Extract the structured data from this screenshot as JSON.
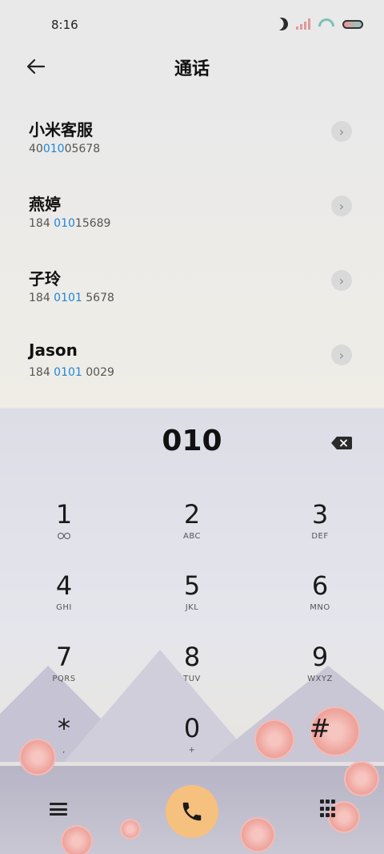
{
  "status_bar": {
    "time": "8:16"
  },
  "header": {
    "title": "通话"
  },
  "contacts": [
    {
      "name": "小米客服",
      "num_pre": "40",
      "num_hl": "010",
      "num_post": "05678"
    },
    {
      "name": "燕婷",
      "num_pre": "184 ",
      "num_hl": "010",
      "num_post": "15689"
    },
    {
      "name": "子玲",
      "num_pre": "184 ",
      "num_hl": "0101",
      "num_post": " 5678"
    },
    {
      "name": "Jason",
      "num_pre": "184 ",
      "num_hl": "0101",
      "num_post": " 0029"
    }
  ],
  "dialer": {
    "digits": "010"
  },
  "keys": [
    {
      "main": "1",
      "sub": ""
    },
    {
      "main": "2",
      "sub": "ABC"
    },
    {
      "main": "3",
      "sub": "DEF"
    },
    {
      "main": "4",
      "sub": "GHI"
    },
    {
      "main": "5",
      "sub": "JKL"
    },
    {
      "main": "6",
      "sub": "MNO"
    },
    {
      "main": "7",
      "sub": "PQRS"
    },
    {
      "main": "8",
      "sub": "TUV"
    },
    {
      "main": "9",
      "sub": "WXYZ"
    },
    {
      "main": "*",
      "sub": ","
    },
    {
      "main": "0",
      "sub": "+"
    },
    {
      "main": "#",
      "sub": ""
    }
  ],
  "colors": {
    "accent_blue": "#1e86d8",
    "call_button": "#f6c07e"
  },
  "icons": [
    "moon-icon",
    "signal-icon",
    "wifi-icon",
    "battery-icon",
    "back-arrow-icon",
    "chevron-right-icon",
    "backspace-icon",
    "voicemail-icon",
    "menu-icon",
    "phone-icon",
    "keypad-icon"
  ]
}
